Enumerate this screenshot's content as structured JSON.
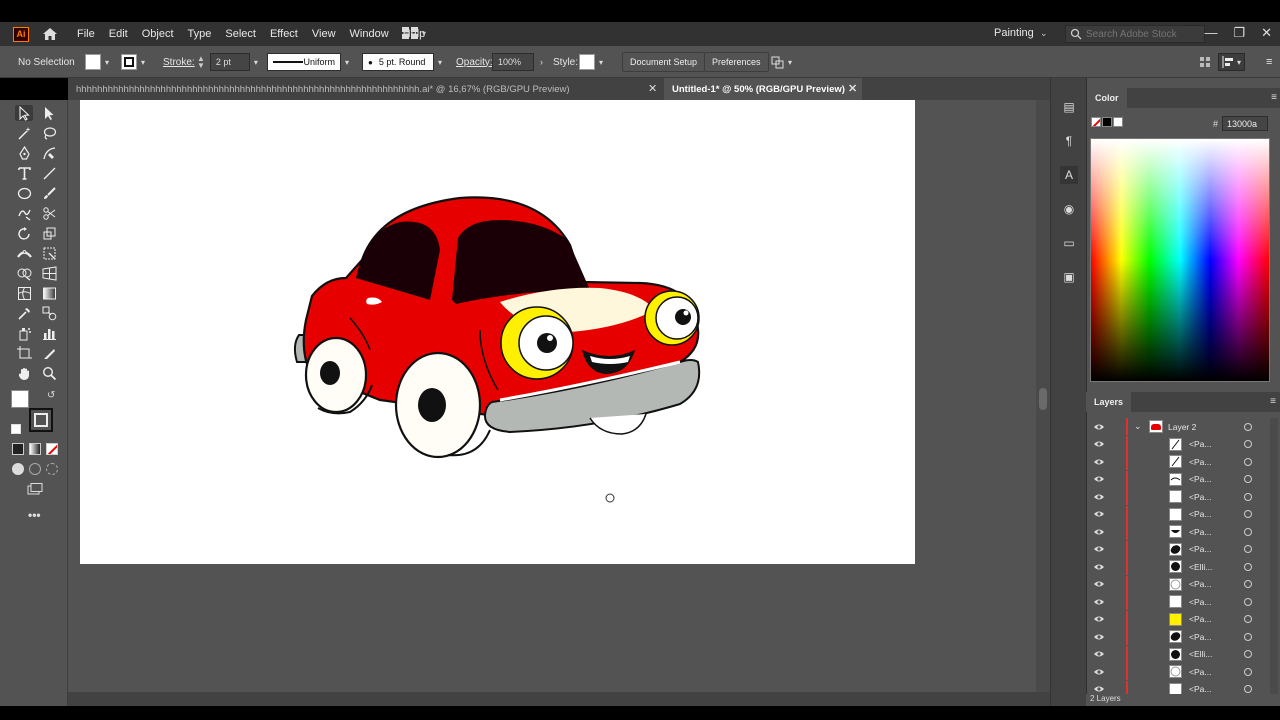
{
  "app": {
    "logo": "Ai",
    "menu": [
      "File",
      "Edit",
      "Object",
      "Type",
      "Select",
      "Effect",
      "View",
      "Window",
      "Help"
    ],
    "workspace": "Painting",
    "search_placeholder": "Search Adobe Stock"
  },
  "control_bar": {
    "selection": "No Selection",
    "stroke_label": "Stroke:",
    "stroke_weight": "2 pt",
    "profile": "Uniform",
    "brush": "5 pt. Round",
    "opacity_label": "Opacity:",
    "opacity": "100%",
    "style_label": "Style:",
    "document_setup": "Document Setup",
    "preferences": "Preferences"
  },
  "tabs": [
    {
      "label": "hhhhhhhhhhhhhhhhhhhhhhhhhhhhhhhhhhhhhhhhhhhhhhhhhhhhhhhhhhhhhhhhh.ai* @ 16,67% (RGB/GPU Preview)",
      "active": false
    },
    {
      "label": "Untitled-1* @ 50% (RGB/GPU Preview)",
      "active": true
    }
  ],
  "color_panel": {
    "title": "Color",
    "hex_prefix": "#",
    "hex_value": "13000a"
  },
  "layers_panel": {
    "title": "Layers",
    "parent_layer": "Layer 2",
    "items": [
      {
        "name": "<Pa...",
        "thumb": "line"
      },
      {
        "name": "<Pa...",
        "thumb": "line"
      },
      {
        "name": "<Pa...",
        "thumb": "curve"
      },
      {
        "name": "<Pa...",
        "thumb": "white"
      },
      {
        "name": "<Pa...",
        "thumb": "white"
      },
      {
        "name": "<Pa...",
        "thumb": "smile"
      },
      {
        "name": "<Pa...",
        "thumb": "blob"
      },
      {
        "name": "<Elli...",
        "thumb": "dot"
      },
      {
        "name": "<Pa...",
        "thumb": "circle"
      },
      {
        "name": "<Pa...",
        "thumb": "white"
      },
      {
        "name": "<Pa...",
        "thumb": "yellow"
      },
      {
        "name": "<Pa...",
        "thumb": "blob"
      },
      {
        "name": "<Elli...",
        "thumb": "dot"
      },
      {
        "name": "<Pa...",
        "thumb": "circle"
      },
      {
        "name": "<Pa...",
        "thumb": "white"
      }
    ],
    "footer": "2 Layers"
  },
  "colors": {
    "car_red": "#e60000",
    "window_dark": "#1a0006",
    "headlight_yellow": "#ffef00",
    "bumper_gray": "#b4b8b4"
  }
}
